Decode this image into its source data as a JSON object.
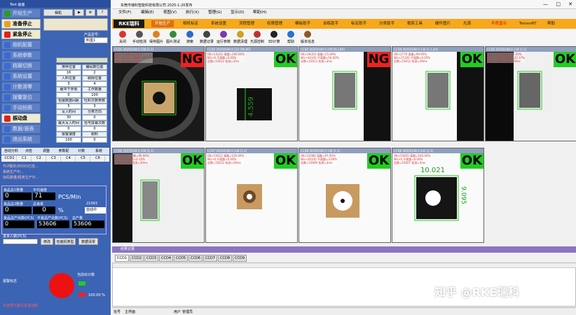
{
  "left": {
    "title": "Test 画面",
    "buttons": [
      {
        "label": "开始生产",
        "state": "dim"
      },
      {
        "label": "准备停止",
        "state": "act"
      },
      {
        "label": "紧急停止",
        "state": "act"
      },
      {
        "label": "相机配置",
        "state": "dim"
      },
      {
        "label": "系统参数",
        "state": "dim"
      },
      {
        "label": "档案切换",
        "state": "dim"
      },
      {
        "label": "系统设置",
        "state": "dim"
      },
      {
        "label": "计数清零",
        "state": "dim"
      },
      {
        "label": "报警复位",
        "state": "dim"
      },
      {
        "label": "手动拍照",
        "state": "dim"
      },
      {
        "label": "振动盘",
        "state": "act"
      },
      {
        "label": "数据/报表",
        "state": "dim"
      },
      {
        "label": "退出系统",
        "state": "dim"
      }
    ],
    "toolbar": [
      "相机",
      "参数",
      "配置",
      "AI"
    ],
    "product_label": "产品型号：",
    "product_value": "料盒1",
    "grid_labels": [
      "排序位置",
      "编码数位置",
      "入料位置",
      "剔除位置",
      "缓冲下界限",
      "工作数量",
      "包装数据间距",
      "吐料次数参数",
      "写入时间",
      "分类方向",
      "最大写入时间",
      "信号屏幕次数",
      "报警速度",
      "剔料"
    ],
    "grid_values": [
      "16",
      "2",
      "3",
      "4",
      "0",
      "100",
      "5",
      "3",
      "30",
      "0",
      "0",
      "0",
      "100",
      "0"
    ],
    "tabs": [
      "自动分料",
      "点检",
      "调整",
      "参数配",
      "计数",
      "系统"
    ],
    "ccd_tabs": [
      "CCD1",
      "C1",
      "C2",
      "C3",
      "C4",
      "C5",
      "C6"
    ],
    "log_lines": [
      "TCP服务(8000)已连...",
      "系统生产中...",
      "标码数量/报表生产中..."
    ],
    "counts": {
      "ok_label": "良品总1数量",
      "ok_value": "0",
      "speed_label": "平均速度",
      "speed_value": "71",
      "speed_unit": "PCS/Min",
      "ng_label": "良品总2数量",
      "ng_value": "0",
      "rate_label": "总良率",
      "rate_value": "0",
      "rate_unit": "%",
      "bad_label": "良品总产出数(PCS)",
      "bad_value": "53606",
      "ng2_label": "不良总产出数(PCS)",
      "ng2_value": "0",
      "total_label": "总产量",
      "total_value": "53606",
      "hour_value": "21093",
      "mode_value": "自动中"
    },
    "input_label": "发单人数(PCS)",
    "buttons2": [
      "修改",
      "包装机类型",
      "数据清零"
    ],
    "alarm_label": "报警标志",
    "legend1": "当前出计数",
    "legend2": "100.00 %",
    "footer": "多选项已进行发送功能"
  },
  "titlebar": "东莞市瑞科智能科技有限公司 2025-1-20发布",
  "top_menu": [
    "文件(F)",
    "编辑(E)",
    "视图(V)",
    "执行(X)",
    "管理(G)",
    "显示(D)",
    "帮助(H)"
  ],
  "nav": {
    "brand": "RKE瑞科",
    "items": [
      "开始生产",
      "相机标定",
      "系统设置",
      "流程管理",
      "权限管理",
      "模板助手",
      "训练助手",
      "标定助手",
      "分类助手",
      "裁剪工具",
      "硬件图片",
      "光源",
      "不良显示",
      "TensorRT",
      "帮助"
    ]
  },
  "tools": [
    "关闭",
    "手动检测",
    "保存图片",
    "图片测试",
    "搜索",
    "数据记录",
    "运行参数",
    "数据清理",
    "光源控制",
    "3D计算",
    "帮助",
    "版本信息"
  ],
  "cams": [
    {
      "head": "CCD1 20250108 0.158 [1,1]",
      "info": [
        "NG>13 离散=0.00%",
        "NG>54(20) 不离散=50.00%",
        "总数=54 检测=0ms"
      ],
      "status": "NG",
      "img": "ring"
    },
    {
      "head": "CCD2 20250108 0.123 [80,80]",
      "info": [
        "OK>13(21) 离散=100.00%",
        "NG>0 不离散=0.00%",
        "总数=53612 检测=3ms"
      ],
      "status": "OK",
      "img": "block",
      "measure": "4.559"
    },
    {
      "head": "CCD3 20250108 0.156 [0,1,80]",
      "info": [
        "OK>26(20) 离散=55.00%",
        "NG>43(20) 不离散=50.00%",
        "总数=53613 检测=3ms"
      ],
      "status": "NG",
      "img": "side"
    },
    {
      "head": "CCD4 20250108 0.134 [1,1,44]",
      "info": [
        "OK>2770 离散=99.95%",
        "NG>27(20) 不离散=0.05%",
        "总数=53612 检测=29ms"
      ],
      "status": "OK",
      "img": "side"
    },
    {
      "head": "CCD5 20250108 0.134 [1,1]",
      "info": [
        "OK>43617 离散=77.60%",
        "NG>11989 不离散=22.37%",
        "总数=53603 检测=29ms"
      ],
      "status": "OK",
      "img": "sidedark"
    },
    {
      "head": "CCD6 20250108 0.156 [1,1]",
      "info": [
        "OK>53527 离散=99.90%",
        "NG>26 不离散=0.10%",
        "总数=53606 检测=30ms"
      ],
      "status": "OK",
      "img": "block2"
    },
    {
      "head": "CCD7 20250108 0.128 [1,1]",
      "info": [
        "OK>53612 离散=100.00%",
        "NG>0 不离散=0.00%",
        "总数=53612 检测=29ms"
      ],
      "status": "OK",
      "img": "square"
    },
    {
      "head": "CCD8 20250108 0.138 [1,1]",
      "info": [
        "OK>52000 离散=97.00%",
        "NG>20(20) 不离散=3.00%",
        "总数=53609 检测=2ms"
      ],
      "status": "OK",
      "img": "squarebig"
    },
    {
      "head": "CCD9 20250108 0.142 [1,1]",
      "info": [
        "OK>53605 离散=100.00%",
        "NG>0 不离散=0.00%",
        "总数=53607 检测=3ms"
      ],
      "status": "OK",
      "img": "measure",
      "measure": "10.021",
      "measure2": "9.095"
    }
  ],
  "panel_title": "结果记录",
  "ccd_log_tabs": [
    "CCD1",
    "CCD2",
    "CCD3",
    "CCD4",
    "CCD5",
    "CCD6",
    "CCD7",
    "CCD8",
    "CCD9"
  ],
  "statusbar": [
    "信号",
    "主界面",
    "用户",
    "管理员"
  ],
  "watermark": "知乎 @RKE瑞科",
  "colors": {
    "ok": "#22cc22",
    "ng": "#ee2222",
    "nav": "#f7a81b",
    "left": "#3c64b4"
  }
}
